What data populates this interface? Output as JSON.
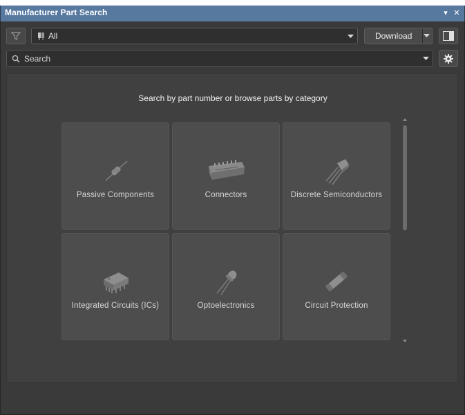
{
  "window": {
    "title": "Manufacturer Part Search",
    "menu_glyph": "▾",
    "close_glyph": "✕"
  },
  "toolbar": {
    "source_value": "All",
    "download_label": "Download"
  },
  "search": {
    "placeholder": "Search"
  },
  "content": {
    "heading": "Search by part number or browse parts by category",
    "categories": [
      {
        "label": "Passive Components",
        "icon": "resistor-icon"
      },
      {
        "label": "Connectors",
        "icon": "connector-icon"
      },
      {
        "label": "Discrete Semiconductors",
        "icon": "transistor-icon"
      },
      {
        "label": "Integrated Circuits (ICs)",
        "icon": "ic-chip-icon"
      },
      {
        "label": "Optoelectronics",
        "icon": "led-icon"
      },
      {
        "label": "Circuit Protection",
        "icon": "fuse-icon"
      }
    ]
  },
  "colors": {
    "titlebar": "#5779a0",
    "panel_bg": "#3a3a3a",
    "tile_bg": "#4d4d4d"
  }
}
